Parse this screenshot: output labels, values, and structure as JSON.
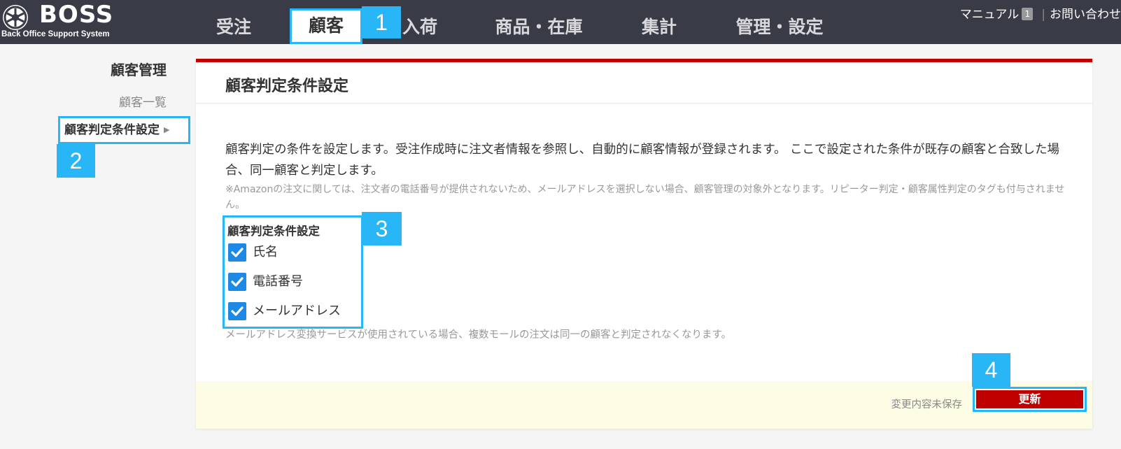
{
  "app": {
    "logo_title": "BOSS",
    "logo_subtitle": "Back Office Support System"
  },
  "nav": {
    "tabs": [
      {
        "label": "受注"
      },
      {
        "label": "顧客"
      },
      {
        "label": "入荷"
      },
      {
        "label": "商品・在庫"
      },
      {
        "label": "集計"
      },
      {
        "label": "管理・設定"
      }
    ]
  },
  "header_links": {
    "manual": "マニュアル",
    "manual_badge": "1",
    "contact": "お問い合わせ"
  },
  "callouts": {
    "c1": "1",
    "c2": "2",
    "c3": "3",
    "c4": "4"
  },
  "sidebar": {
    "title": "顧客管理",
    "items": [
      {
        "label": "顧客一覧"
      },
      {
        "label": "顧客判定条件設定"
      }
    ]
  },
  "page": {
    "title": "顧客判定条件設定",
    "description": "顧客判定の条件を設定します。受注作成時に注文者情報を参照し、自動的に顧客情報が登録されます。 ここで設定された条件が既存の顧客と合致した場合、同一顧客と判定します。",
    "note": "※Amazonの注文に関しては、注文者の電話番号が提供されないため、メールアドレスを選択しない場合、顧客管理の対象外となります。リピーター判定・顧客属性判定のタグも付与されません。",
    "settings_label": "顧客判定条件設定",
    "checkboxes": [
      {
        "label": "氏名",
        "checked": true
      },
      {
        "label": "電話番号",
        "checked": true
      },
      {
        "label": "メールアドレス",
        "checked": true
      }
    ],
    "hint": "メールアドレス変換サービスが使用されている場合、複数モールの注文は同一の顧客と判定されなくなります。",
    "unsaved_status": "変更内容未保存",
    "update_button": "更新"
  },
  "colors": {
    "topbar": "#393b46",
    "accent_red": "#c00000",
    "callout_blue": "#29b6f6",
    "checkbox_blue": "#1e88e5",
    "footer_bg": "#fdfde6"
  }
}
